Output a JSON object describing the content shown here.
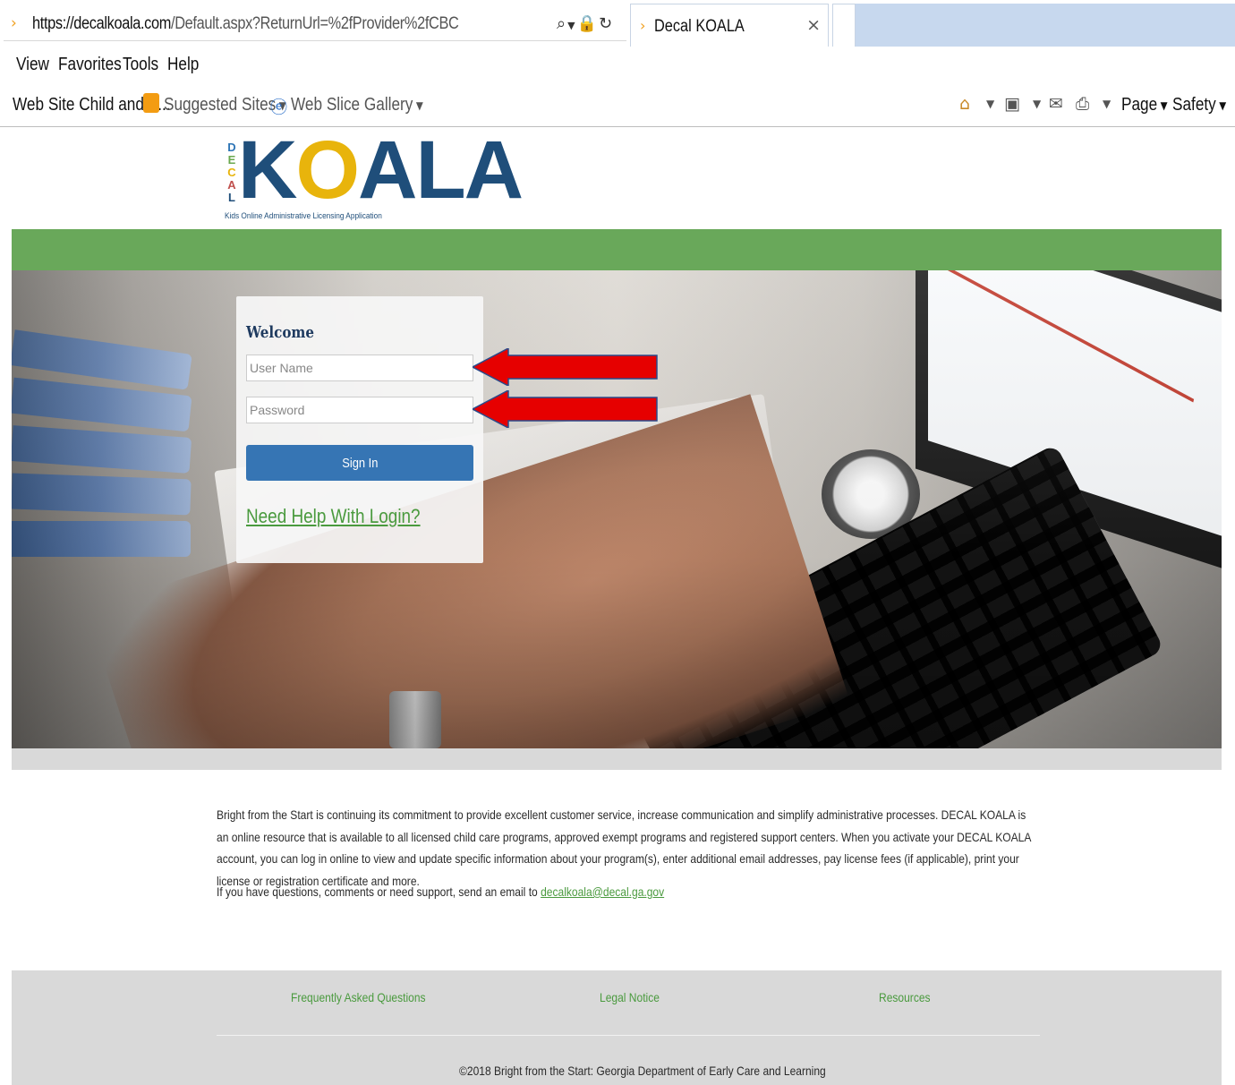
{
  "browser": {
    "url_host": "https://decalkoala.com",
    "url_path": "/Default.aspx?ReturnUrl=%2fProvider%2fCBC",
    "tab_title": "Decal KOALA",
    "tab_close": "×",
    "menu": [
      "View",
      "Favorites",
      "Tools",
      "Help"
    ],
    "favorites": [
      {
        "label": "Web Site Child and A...",
        "icon": "page-icon"
      },
      {
        "label": "Suggested Sites",
        "icon": "suggested-sites-icon"
      },
      {
        "label": "Web Slice Gallery",
        "icon": "ie-icon"
      }
    ],
    "toolbar": {
      "page_label": "Page",
      "safety_label": "Safety"
    }
  },
  "logo": {
    "decal_letters": [
      "D",
      "E",
      "C",
      "A",
      "L"
    ],
    "koala_prefix": "K",
    "koala_o": "O",
    "koala_suffix": "ALA",
    "tagline": "Kids Online Administrative Licensing Application",
    "colors": {
      "navy": "#1f4e7a",
      "gold": "#e8b40c",
      "decal": [
        "#2e75b6",
        "#6aa84f",
        "#e8b40c",
        "#c0504d",
        "#1f4e7a"
      ]
    }
  },
  "login": {
    "welcome": "Welcome",
    "username_placeholder": "User Name",
    "password_placeholder": "Password",
    "signin_label": "Sign In",
    "help_link": "Need Help With Login?"
  },
  "body": {
    "intro": "Bright from the Start is continuing its commitment to provide excellent customer service, increase communication and simplify administrative processes. DECAL KOALA is an online resource that is available to all licensed child care programs, approved exempt programs and registered support centers. When you activate your DECAL KOALA account, you can log in online to view and update specific information about your program(s), enter additional email addresses, pay license fees (if applicable), print your license or registration certificate and more.",
    "support_prefix": "If you have questions, comments or need support, send an email to",
    "support_email": "decalkoala@decal.ga.gov"
  },
  "footer": {
    "links": [
      "Frequently Asked Questions",
      "Legal Notice",
      "Resources"
    ],
    "copyright": "©2018 Bright from the Start: Georgia Department of Early Care and Learning"
  },
  "colors": {
    "green_bar": "#69a85a",
    "signin_button": "#3675b4",
    "link_green": "#4a9a3e",
    "annotation_arrow": "#e60000"
  }
}
